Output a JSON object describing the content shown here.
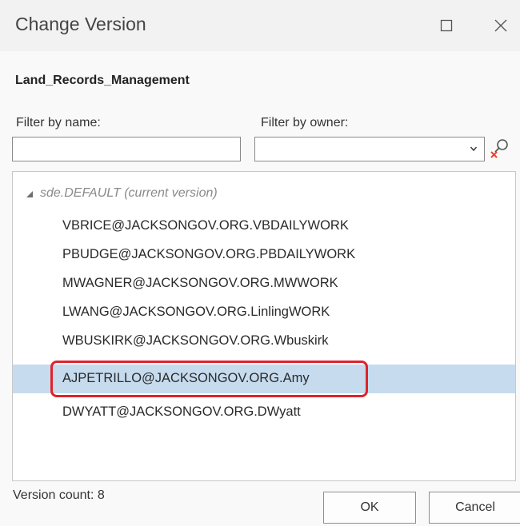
{
  "window": {
    "title": "Change Version",
    "maximize_icon": "maximize-icon",
    "close_icon": "close-icon"
  },
  "database": {
    "name": "Land_Records_Management"
  },
  "filters": {
    "name_label": "Filter by name:",
    "name_value": "",
    "owner_label": "Filter by owner:",
    "owner_value": "",
    "clear_icon": "search-clear-icon"
  },
  "versions": {
    "root_label": "sde.DEFAULT (current version)",
    "items": [
      "VBRICE@JACKSONGOV.ORG.VBDAILYWORK",
      "PBUDGE@JACKSONGOV.ORG.PBDAILYWORK",
      "MWAGNER@JACKSONGOV.ORG.MWWORK",
      "LWANG@JACKSONGOV.ORG.LinlingWORK",
      "WBUSKIRK@JACKSONGOV.ORG.Wbuskirk",
      "AJPETRILLO@JACKSONGOV.ORG.Amy",
      "DWYATT@JACKSONGOV.ORG.DWyatt"
    ],
    "selected": "AJPETRILLO@JACKSONGOV.ORG.Amy"
  },
  "footer": {
    "version_count": "Version count: 8",
    "ok_label": "OK",
    "cancel_label": "Cancel"
  },
  "colors": {
    "selection": "#c6dbee",
    "highlight_outline": "#e0232b",
    "clear_x": "#e8452c"
  }
}
